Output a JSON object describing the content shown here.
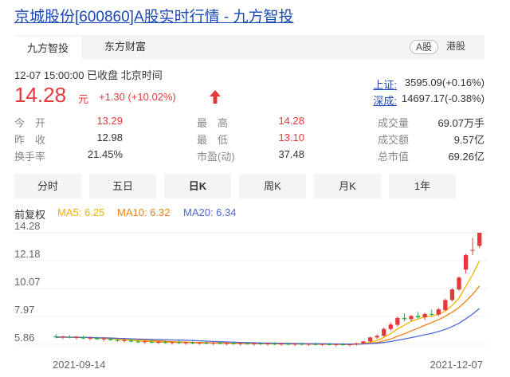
{
  "title": "京城股份[600860]A股实时行情 - 九方智投",
  "tabs": [
    {
      "label": "九方智投",
      "active": true
    },
    {
      "label": "东方财富",
      "active": false
    }
  ],
  "market_toggle": [
    {
      "label": "A股",
      "active": true
    },
    {
      "label": "港股",
      "active": false
    }
  ],
  "status_line": "12-07 15:00:00  已收盘  北京时间",
  "price": {
    "value": "14.28",
    "unit": "元",
    "change": "+1.30 (+10.02%)",
    "direction": "up"
  },
  "indices": [
    {
      "name": "上证:",
      "value": "3595.09(+0.16%)"
    },
    {
      "name": "深成:",
      "value": "14697.17(-0.38%)"
    }
  ],
  "quote_rows": [
    [
      {
        "label": "今　开",
        "value": "13.29",
        "color": "red"
      },
      {
        "label": "最　高",
        "value": "14.28",
        "color": "red"
      },
      {
        "label": "成交量",
        "value": "69.07万手",
        "color": "dark"
      }
    ],
    [
      {
        "label": "昨　收",
        "value": "12.98",
        "color": "dark"
      },
      {
        "label": "最　低",
        "value": "13.10",
        "color": "red"
      },
      {
        "label": "成交额",
        "value": "9.57亿",
        "color": "dark"
      }
    ],
    [
      {
        "label": "换手率",
        "value": "21.45%",
        "color": "dark"
      },
      {
        "label": "市盈(动)",
        "value": "37.48",
        "color": "dark"
      },
      {
        "label": "总市值",
        "value": "69.26亿",
        "color": "dark"
      }
    ]
  ],
  "kline_tabs": [
    {
      "label": "分时",
      "active": false
    },
    {
      "label": "五日",
      "active": false
    },
    {
      "label": "日K",
      "active": true
    },
    {
      "label": "周K",
      "active": false
    },
    {
      "label": "月K",
      "active": false
    },
    {
      "label": "1年",
      "active": false
    }
  ],
  "legend": {
    "adjust": "前复权",
    "items": [
      {
        "text": "MA5: 6.25",
        "color": "#f5b400"
      },
      {
        "text": "MA10: 6.32",
        "color": "#f07f13"
      },
      {
        "text": "MA20: 6.34",
        "color": "#4c6ad6"
      }
    ]
  },
  "colors": {
    "up": "#e4393c",
    "down": "#2aa84a",
    "link": "#1a49b5"
  },
  "chart_data": {
    "type": "candlestick",
    "y_ticks": [
      "14.28",
      "12.18",
      "10.07",
      "7.97",
      "5.86"
    ],
    "ylim": [
      5.86,
      14.28
    ],
    "x_ticks": [
      "2021-09-14",
      "2021-12-07"
    ],
    "candles": [
      {
        "o": 6.47,
        "h": 6.61,
        "l": 6.31,
        "c": 6.39
      },
      {
        "o": 6.38,
        "h": 6.52,
        "l": 6.25,
        "c": 6.44
      },
      {
        "o": 6.42,
        "h": 6.55,
        "l": 6.31,
        "c": 6.36
      },
      {
        "o": 6.35,
        "h": 6.49,
        "l": 6.22,
        "c": 6.41
      },
      {
        "o": 6.4,
        "h": 6.51,
        "l": 6.25,
        "c": 6.3
      },
      {
        "o": 6.3,
        "h": 6.43,
        "l": 6.16,
        "c": 6.35
      },
      {
        "o": 6.33,
        "h": 6.44,
        "l": 6.19,
        "c": 6.24
      },
      {
        "o": 6.24,
        "h": 6.38,
        "l": 6.11,
        "c": 6.29
      },
      {
        "o": 6.27,
        "h": 6.4,
        "l": 6.13,
        "c": 6.18
      },
      {
        "o": 6.18,
        "h": 6.31,
        "l": 6.06,
        "c": 6.13
      },
      {
        "o": 6.12,
        "h": 6.25,
        "l": 6.0,
        "c": 6.17
      },
      {
        "o": 6.15,
        "h": 6.27,
        "l": 6.02,
        "c": 6.07
      },
      {
        "o": 6.07,
        "h": 6.19,
        "l": 5.95,
        "c": 6.02
      },
      {
        "o": 6.02,
        "h": 6.14,
        "l": 5.9,
        "c": 6.08
      },
      {
        "o": 6.06,
        "h": 6.18,
        "l": 5.94,
        "c": 5.99
      },
      {
        "o": 5.99,
        "h": 6.1,
        "l": 5.87,
        "c": 6.04
      },
      {
        "o": 6.03,
        "h": 6.14,
        "l": 5.91,
        "c": 5.96
      },
      {
        "o": 5.96,
        "h": 6.07,
        "l": 5.84,
        "c": 6.02
      },
      {
        "o": 6.01,
        "h": 6.12,
        "l": 5.89,
        "c": 5.95
      },
      {
        "o": 5.95,
        "h": 6.06,
        "l": 5.83,
        "c": 6.0
      },
      {
        "o": 5.99,
        "h": 6.1,
        "l": 5.87,
        "c": 5.93
      },
      {
        "o": 5.93,
        "h": 6.04,
        "l": 5.82,
        "c": 5.98
      },
      {
        "o": 5.97,
        "h": 6.08,
        "l": 5.86,
        "c": 5.92
      },
      {
        "o": 5.92,
        "h": 6.03,
        "l": 5.81,
        "c": 5.97
      },
      {
        "o": 5.96,
        "h": 6.07,
        "l": 5.85,
        "c": 5.9
      },
      {
        "o": 5.9,
        "h": 6.01,
        "l": 5.79,
        "c": 5.95
      },
      {
        "o": 5.94,
        "h": 6.05,
        "l": 5.83,
        "c": 5.89
      },
      {
        "o": 5.89,
        "h": 6.0,
        "l": 5.78,
        "c": 5.94
      },
      {
        "o": 5.93,
        "h": 6.04,
        "l": 5.82,
        "c": 5.88
      },
      {
        "o": 5.88,
        "h": 5.99,
        "l": 5.77,
        "c": 5.93
      },
      {
        "o": 5.92,
        "h": 6.03,
        "l": 5.81,
        "c": 5.87
      },
      {
        "o": 5.87,
        "h": 5.98,
        "l": 5.76,
        "c": 5.92
      },
      {
        "o": 5.91,
        "h": 6.02,
        "l": 5.8,
        "c": 5.86
      },
      {
        "o": 5.86,
        "h": 5.97,
        "l": 5.75,
        "c": 5.91
      },
      {
        "o": 5.9,
        "h": 6.01,
        "l": 5.79,
        "c": 5.85
      },
      {
        "o": 5.85,
        "h": 5.96,
        "l": 5.74,
        "c": 5.9
      },
      {
        "o": 5.89,
        "h": 6.0,
        "l": 5.78,
        "c": 5.84
      },
      {
        "o": 5.84,
        "h": 5.95,
        "l": 5.73,
        "c": 5.89
      },
      {
        "o": 5.88,
        "h": 5.99,
        "l": 5.77,
        "c": 5.83
      },
      {
        "o": 5.83,
        "h": 5.94,
        "l": 5.72,
        "c": 5.88
      },
      {
        "o": 5.87,
        "h": 5.98,
        "l": 5.76,
        "c": 5.82
      },
      {
        "o": 5.82,
        "h": 5.93,
        "l": 5.71,
        "c": 5.87
      },
      {
        "o": 5.86,
        "h": 5.97,
        "l": 5.75,
        "c": 5.81
      },
      {
        "o": 5.81,
        "h": 5.92,
        "l": 5.7,
        "c": 5.86
      },
      {
        "o": 5.86,
        "h": 5.98,
        "l": 5.76,
        "c": 5.94
      },
      {
        "o": 5.93,
        "h": 6.12,
        "l": 5.86,
        "c": 6.08
      },
      {
        "o": 6.08,
        "h": 6.43,
        "l": 6.0,
        "c": 6.38
      },
      {
        "o": 6.38,
        "h": 6.6,
        "l": 6.26,
        "c": 6.5
      },
      {
        "o": 6.5,
        "h": 7.12,
        "l": 6.42,
        "c": 7.02
      },
      {
        "o": 7.02,
        "h": 7.5,
        "l": 6.9,
        "c": 7.35
      },
      {
        "o": 7.33,
        "h": 7.95,
        "l": 7.2,
        "c": 7.85
      },
      {
        "o": 7.85,
        "h": 8.2,
        "l": 7.6,
        "c": 7.76
      },
      {
        "o": 7.76,
        "h": 8.08,
        "l": 7.6,
        "c": 8.0
      },
      {
        "o": 8.0,
        "h": 8.3,
        "l": 7.8,
        "c": 7.9
      },
      {
        "o": 7.9,
        "h": 8.25,
        "l": 7.7,
        "c": 8.15
      },
      {
        "o": 8.15,
        "h": 8.48,
        "l": 8.0,
        "c": 8.1
      },
      {
        "o": 8.1,
        "h": 8.62,
        "l": 8.0,
        "c": 8.5
      },
      {
        "o": 8.45,
        "h": 9.3,
        "l": 8.38,
        "c": 9.2
      },
      {
        "o": 9.2,
        "h": 10.1,
        "l": 9.1,
        "c": 10.0
      },
      {
        "o": 10.0,
        "h": 11.0,
        "l": 9.9,
        "c": 10.9
      },
      {
        "o": 11.5,
        "h": 12.7,
        "l": 11.2,
        "c": 12.6
      },
      {
        "o": 12.98,
        "h": 13.9,
        "l": 12.6,
        "c": 12.98
      },
      {
        "o": 13.29,
        "h": 14.28,
        "l": 13.1,
        "c": 14.28
      }
    ]
  }
}
